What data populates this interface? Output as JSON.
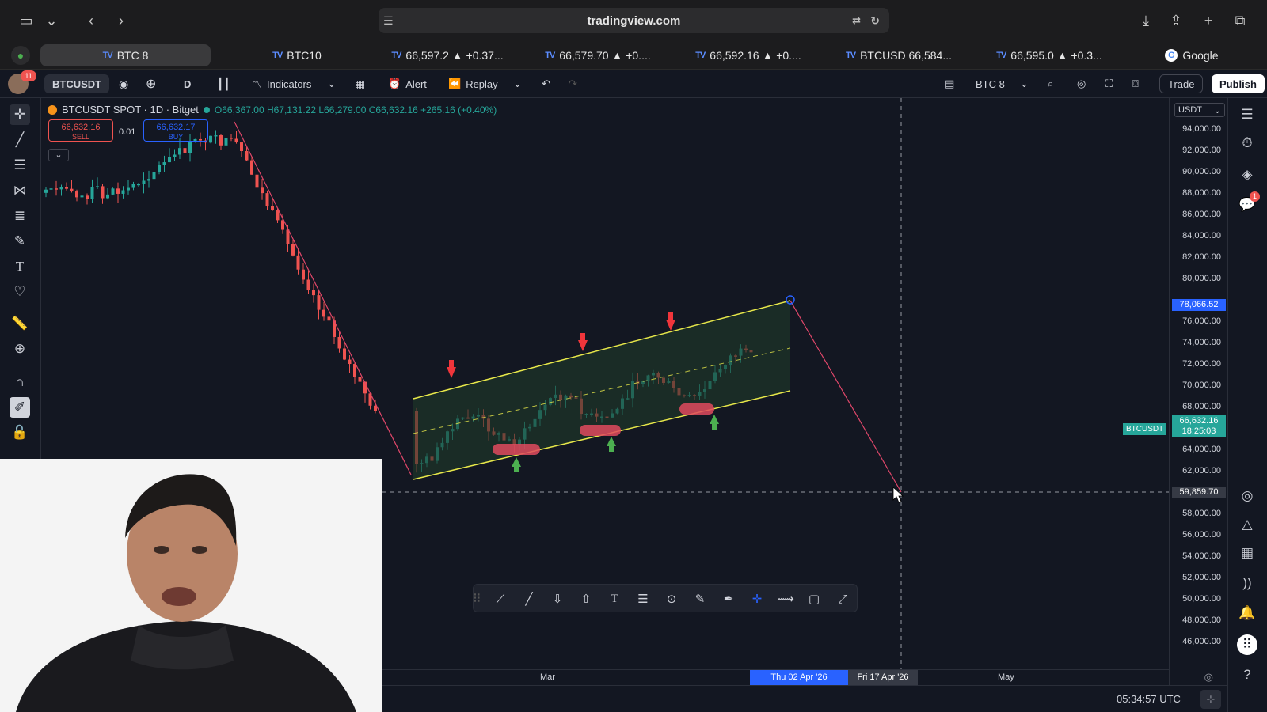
{
  "browser": {
    "url": "tradingview.com",
    "tabs": [
      {
        "label": "BTC 8",
        "active": true
      },
      {
        "label": "BTC10"
      },
      {
        "label": "66,597.2 ▲ +0.37..."
      },
      {
        "label": "66,579.70 ▲ +0...."
      },
      {
        "label": "66,592.16 ▲ +0...."
      },
      {
        "label": "BTCUSD 66,584..."
      },
      {
        "label": "66,595.0 ▲ +0.3..."
      },
      {
        "label": "Google"
      }
    ],
    "tv_logo": "TV"
  },
  "toolbar": {
    "notifications_badge": "11",
    "symbol": "BTCUSDT",
    "interval": "D",
    "indicators_label": "Indicators",
    "alert_label": "Alert",
    "replay_label": "Replay",
    "layout_name": "BTC 8",
    "trade_label": "Trade",
    "publish_label": "Publish"
  },
  "legend": {
    "title": "BTCUSDT SPOT · 1D · Bitget",
    "ohlc": "O66,367.00 H67,131.22 L66,279.00 C66,632.16 +265.16 (+0.40%)",
    "sell_price": "66,632.16",
    "sell_label": "SELL",
    "spread": "0.01",
    "buy_price": "66,632.17",
    "buy_label": "BUY"
  },
  "price_axis": {
    "currency": "USDT",
    "labels": [
      "94,000.00",
      "92,000.00",
      "90,000.00",
      "88,000.00",
      "86,000.00",
      "84,000.00",
      "82,000.00",
      "80,000.00",
      "76,000.00",
      "74,000.00",
      "72,000.00",
      "70,000.00",
      "68,000.00",
      "64,000.00",
      "62,000.00",
      "58,000.00",
      "56,000.00",
      "54,000.00",
      "52,000.00",
      "50,000.00",
      "48,000.00",
      "46,000.00"
    ],
    "highlight_price": "78,066.52",
    "crosshair_price": "59,859.70",
    "last_symbol": "BTCUSDT",
    "last_price": "66,632.16",
    "countdown": "18:25:03"
  },
  "time_axis": {
    "labels": [
      "Mar",
      "May"
    ],
    "highlight_date": "Thu 02 Apr '26",
    "crosshair_date": "Fri 17 Apr '26"
  },
  "status": {
    "clock": "05:34:57 UTC"
  },
  "right_panel": {
    "badge": "1"
  },
  "colors": {
    "bg": "#131722",
    "up": "#26a69a",
    "down": "#ef5350",
    "channel": "#e8e84a",
    "projection": "#e0476a",
    "accent": "#2962ff"
  },
  "chart_data": {
    "type": "candlestick",
    "symbol": "BTCUSDT",
    "interval": "1D",
    "ylim": [
      45000,
      95500
    ],
    "annotations": [
      "ascending channel",
      "sell arrows at upper band",
      "buy arrows at lower band",
      "projected drop line to 59,859.70"
    ]
  }
}
